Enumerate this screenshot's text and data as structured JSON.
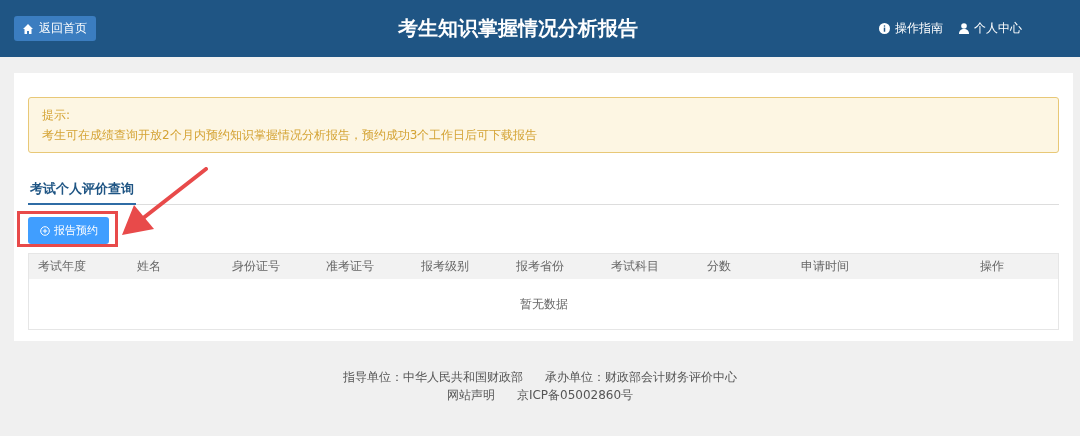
{
  "header": {
    "back_button": "返回首页",
    "title": "考生知识掌握情况分析报告",
    "guide_link": "操作指南",
    "user_link": "个人中心"
  },
  "notice": {
    "title": "提示:",
    "text": "考生可在成绩查询开放2个月内预约知识掌握情况分析报告，预约成功3个工作日后可下载报告"
  },
  "tabs": [
    {
      "label": "考试个人评价查询",
      "selected": true
    }
  ],
  "reserve_button": "报告预约",
  "table": {
    "columns": [
      "考试年度",
      "姓名",
      "身份证号",
      "准考证号",
      "报考级别",
      "报考省份",
      "考试科目",
      "分数",
      "申请时间",
      "操作"
    ],
    "empty_text": "暂无数据"
  },
  "footer": {
    "line_1": [
      "指导单位：中华人民共和国财政部",
      "承办单位：财政部会计财务评价中心"
    ],
    "line_2": [
      "网站声明",
      "京ICP备05002860号"
    ]
  }
}
